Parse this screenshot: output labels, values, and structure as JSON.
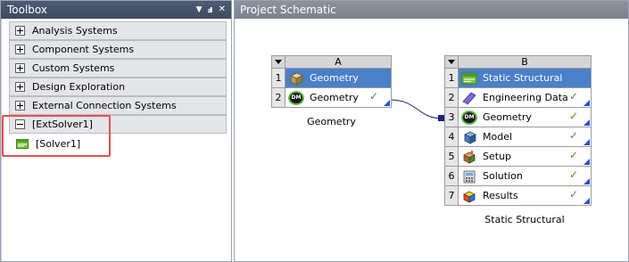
{
  "toolbox": {
    "title": "Toolbox",
    "controls": {
      "dropdown": "▼",
      "pin": "ⅎ",
      "close": "✕"
    },
    "categories": [
      {
        "label": "Analysis Systems",
        "expanded": false
      },
      {
        "label": "Component Systems",
        "expanded": false
      },
      {
        "label": "Custom Systems",
        "expanded": false
      },
      {
        "label": "Design Exploration",
        "expanded": false
      },
      {
        "label": "External Connection Systems",
        "expanded": false
      },
      {
        "label": "[ExtSolver1]",
        "expanded": true
      }
    ],
    "solver_item": {
      "label": "[Solver1]",
      "icon": "solver-icon"
    }
  },
  "schematic": {
    "title": "Project Schematic",
    "systemA": {
      "column": "A",
      "caption": "Geometry",
      "rows": [
        {
          "num": "1",
          "label": "Geometry",
          "icon": "geometry-box-icon",
          "title": true
        },
        {
          "num": "2",
          "label": "Geometry",
          "icon": "designmodeler-icon",
          "check": "✓",
          "corner": true
        }
      ]
    },
    "systemB": {
      "column": "B",
      "caption": "Static Structural",
      "rows": [
        {
          "num": "1",
          "label": "Static Structural",
          "icon": "static-structural-icon",
          "title": true
        },
        {
          "num": "2",
          "label": "Engineering Data",
          "icon": "engineering-data-icon",
          "check": "✓",
          "corner": true
        },
        {
          "num": "3",
          "label": "Geometry",
          "icon": "designmodeler-icon",
          "check": "✓",
          "corner": true
        },
        {
          "num": "4",
          "label": "Model",
          "icon": "model-icon",
          "check": "✓",
          "corner": true
        },
        {
          "num": "5",
          "label": "Setup",
          "icon": "setup-icon",
          "check": "✓",
          "corner": true
        },
        {
          "num": "6",
          "label": "Solution",
          "icon": "solution-icon",
          "check": "✓",
          "corner": true
        },
        {
          "num": "7",
          "label": "Results",
          "icon": "results-icon",
          "check": "✓",
          "corner": true
        }
      ]
    }
  },
  "colors": {
    "title_row": "#4a80c8",
    "check": "#3e9a2c",
    "highlight": "#e8514f",
    "link": "#1a237e"
  }
}
